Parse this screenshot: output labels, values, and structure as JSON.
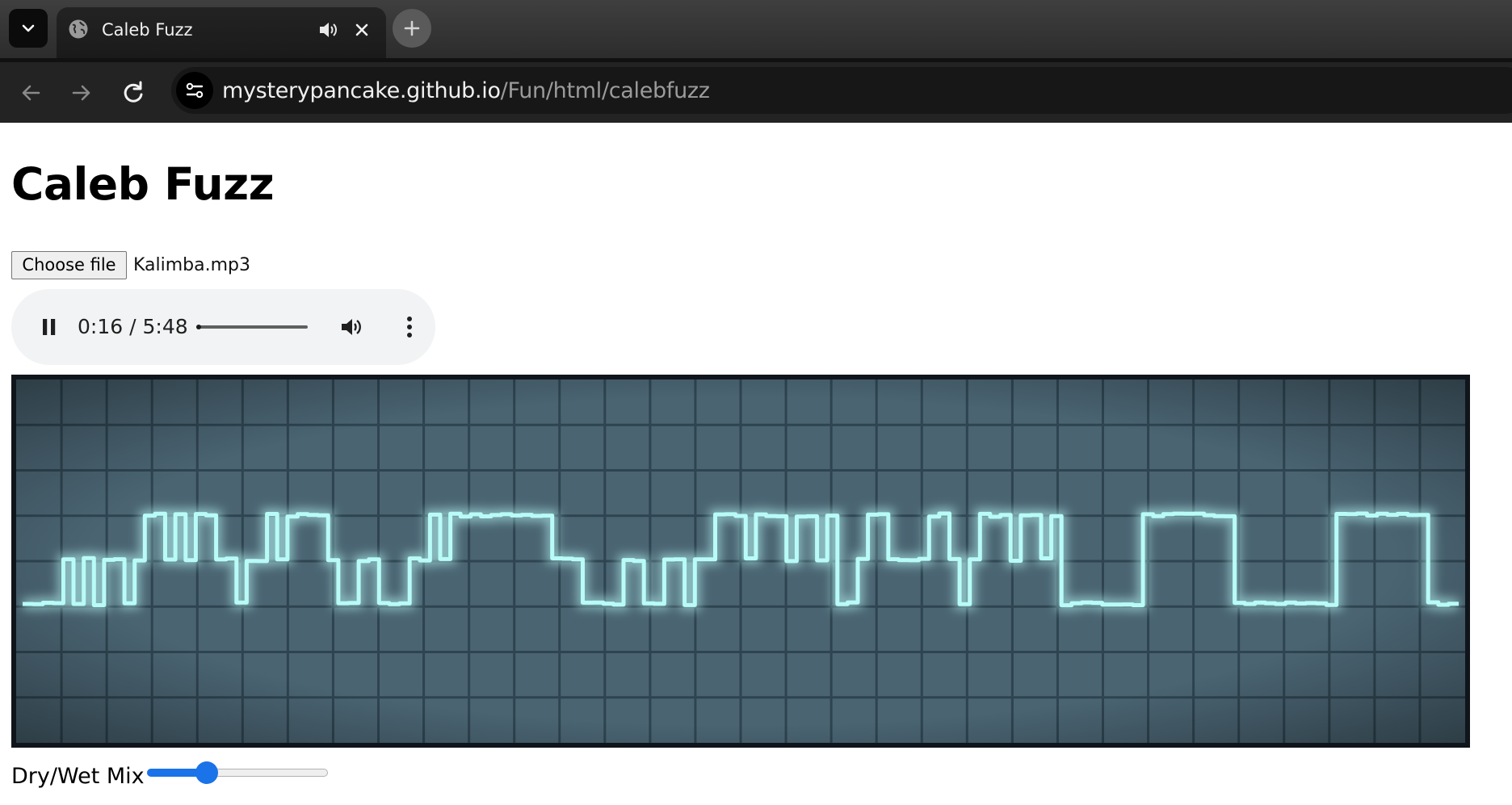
{
  "browser": {
    "tab": {
      "title": "Caleb Fuzz"
    },
    "url": {
      "host": "mysterypancake.github.io",
      "path": "/Fun/html/calebfuzz"
    }
  },
  "page": {
    "heading": "Caleb Fuzz",
    "file_input": {
      "button_label": "Choose file",
      "file_name": "Kalimba.mp3"
    },
    "audio": {
      "current_time": "0:16",
      "separator": "/",
      "duration": "5:48",
      "progress_fraction": 0.0463,
      "state": "playing"
    },
    "oscilloscope": {
      "colors": {
        "background": "#4a6472",
        "grid": "#2e4450",
        "trace": "#b8fbf7",
        "frame": "#10151c"
      },
      "waveform_levels": [
        0,
        0,
        0,
        0,
        1,
        0,
        1,
        0,
        1,
        1,
        0,
        1,
        2,
        2,
        1,
        2,
        1,
        2,
        2,
        1,
        1,
        0,
        1,
        1,
        2,
        1,
        2,
        2,
        2,
        2,
        1,
        0,
        0,
        1,
        1,
        0,
        0,
        0,
        1,
        1,
        2,
        1,
        2,
        2,
        2,
        2,
        2,
        2,
        2,
        2,
        2,
        2,
        1,
        1,
        1,
        0,
        0,
        0,
        0,
        1,
        1,
        0,
        0,
        1,
        1,
        0,
        1,
        1,
        2,
        2,
        2,
        1,
        2,
        2,
        2,
        1,
        2,
        2,
        1,
        2,
        0,
        0,
        1,
        2,
        2,
        1,
        1,
        1,
        1,
        2,
        2,
        1,
        0,
        1,
        2,
        2,
        2,
        1,
        2,
        2,
        1,
        2,
        0,
        0,
        0,
        0,
        0,
        0,
        0,
        0,
        2,
        2,
        2,
        2,
        2,
        2,
        2,
        2,
        2,
        0,
        0,
        0,
        0,
        0,
        0,
        0,
        0,
        0,
        0,
        2,
        2,
        2,
        2,
        2,
        2,
        2,
        2,
        2,
        0,
        0,
        0
      ]
    },
    "mix": {
      "label": "Dry/Wet Mix",
      "value_fraction": 0.33
    }
  }
}
